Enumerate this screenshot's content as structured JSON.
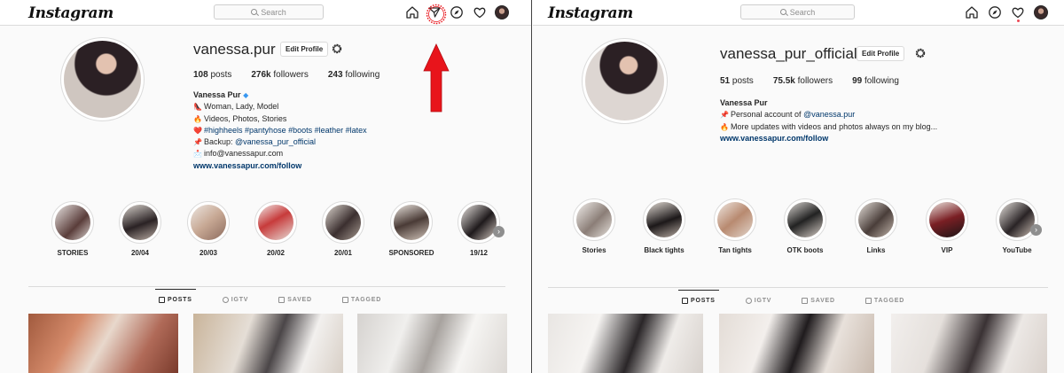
{
  "left": {
    "app_logo": "Instagram",
    "search_placeholder": "Search",
    "profile": {
      "username": "vanessa.pur",
      "edit_button": "Edit Profile",
      "stats": [
        {
          "num": "108",
          "label": " posts"
        },
        {
          "num": "276k",
          "label": " followers"
        },
        {
          "num": "243",
          "label": " following"
        }
      ],
      "bio_name": "Vanessa Pur",
      "bio_lines": [
        {
          "emoji": "👠",
          "text": "Woman, Lady, Model"
        },
        {
          "emoji": "🔥",
          "text": "Videos, Photos, Stories"
        },
        {
          "emoji": "❤️",
          "text": "#highheels #pantyhose #boots #leather #latex",
          "tag": true
        },
        {
          "emoji": "📌",
          "prefix": "Backup: ",
          "text": "@vanessa_pur_official",
          "tag": true
        },
        {
          "emoji": "📩",
          "text": "info@vanessapur.com"
        }
      ],
      "bio_link": "www.vanessapur.com/follow"
    },
    "highlights": [
      "STORIES",
      "20/04",
      "20/03",
      "20/02",
      "20/01",
      "SPONSORED",
      "19/12"
    ],
    "tabs": [
      "POSTS",
      "IGTV",
      "SAVED",
      "TAGGED"
    ]
  },
  "right": {
    "app_logo": "Instagram",
    "search_placeholder": "Search",
    "profile": {
      "username": "vanessa_pur_official",
      "edit_button": "Edit Profile",
      "stats": [
        {
          "num": "51",
          "label": " posts"
        },
        {
          "num": "75.5k",
          "label": " followers"
        },
        {
          "num": "99",
          "label": " following"
        }
      ],
      "bio_name": "Vanessa Pur",
      "bio_lines": [
        {
          "emoji": "📌",
          "prefix": "Personal account of ",
          "text": "@vanessa.pur",
          "tag": true
        },
        {
          "emoji": "🔥",
          "text": "More updates with videos and photos always on my blog..."
        }
      ],
      "bio_link": "www.vanessapur.com/follow"
    },
    "highlights": [
      "Stories",
      "Black tights",
      "Tan tights",
      "OTK boots",
      "Links",
      "VIP",
      "YouTube"
    ],
    "tabs": [
      "POSTS",
      "IGTV",
      "SAVED",
      "TAGGED"
    ]
  },
  "colors": {
    "link": "#00376b",
    "arrow": "#e8141b",
    "badge": "#3897f0",
    "notification": "#ed4956"
  }
}
